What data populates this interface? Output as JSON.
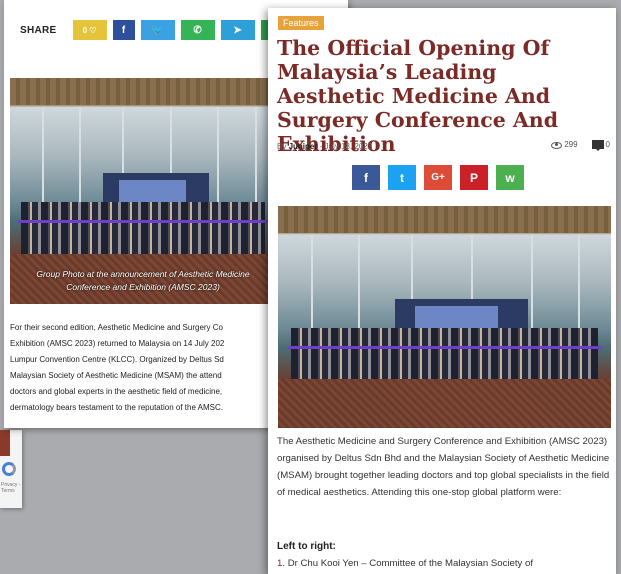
{
  "sliver": {
    "captcha_text": "Privacy - Terms"
  },
  "back_card": {
    "share_label": "SHARE",
    "like_count": "0",
    "caption_lines": [
      "Group Photo at the announcement of Aesthetic Medicine",
      "Conference and Exhibition (AMSC 2023)"
    ],
    "text_lines": [
      "For their second edition, Aesthetic Medicine and Surgery Co",
      "Exhibition (AMSC 2023) returned to Malaysia on 14 July 202",
      "Lumpur Convention Centre (KLCC). Organized by Deltus Sd",
      "Malaysian Society of Aesthetic Medicine (MSAM) the attend",
      "doctors and global experts in the aesthetic field of medicine,",
      "dermatology bears testament to the reputation of the AMSC."
    ]
  },
  "front_card": {
    "category": "Features",
    "title": "The Official Opening Of Malaysia’s Leading Aesthetic Medicine And Surgery Conference And Exhibition",
    "by_prefix": "By",
    "author": "Juniper",
    "date": "- July 18, 2023",
    "views": "299",
    "comments": "0",
    "share_buttons": [
      "f",
      "t",
      "G+",
      "P",
      "w"
    ],
    "body": "The Aesthetic Medicine and Surgery Conference and Exhibition (AMSC 2023) organised by Deltus Sdn Bhd and the Malaysian Society of Aesthetic Medicine (MSAM) brought together leading doctors and top global specialists in the field of medical aesthetics. Attending this one-stop global platform were:",
    "list_heading": "Left to right:",
    "list_num": "1.",
    "list_first": "Dr Chu Kooi Yen – Committee of the Malaysian Society of"
  },
  "colors": {
    "title": "#7b2a25",
    "category_tag": "#e8a23a",
    "facebook": "#3b5998",
    "twitter": "#1da1f2",
    "google_plus": "#dd4b39",
    "pinterest": "#cb2027",
    "whatsapp": "#4caf50"
  }
}
